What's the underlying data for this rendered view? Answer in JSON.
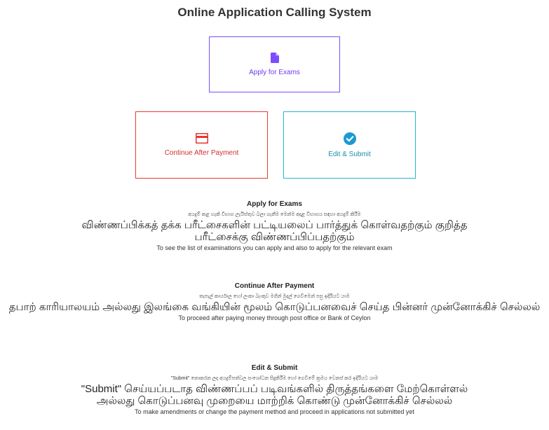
{
  "page": {
    "title": "Online Application Calling System"
  },
  "cards": {
    "apply": {
      "label": "Apply for Exams",
      "icon": "document-icon",
      "color": "#7c4dff"
    },
    "continue": {
      "label": "Continue After Payment",
      "icon": "credit-card-icon",
      "color": "#e53935"
    },
    "edit": {
      "label": "Edit & Submit",
      "icon": "check-circle-icon",
      "color": "#26b5d3"
    }
  },
  "sections": {
    "apply": {
      "heading": "Apply for Exams",
      "sinhala": "අයදුම් කළ හැකි විභාග ලැයිස්තුව බලා ගැනීම මෙන්ම අදාළ විභාගය සඳහා අයදුම් කිරීම",
      "tamil": "விண்ணப்பிக்கத் தக்க பரீட்சைகளின் பட்டியலைப் பார்த்துக் கொள்வதற்கும் குறித்த பரீட்சைக்கு விண்ணப்பிப்பதற்கும்",
      "english": "To see the list of examinations you can apply and also to apply for the relevant exam"
    },
    "continue": {
      "heading": "Continue After Payment",
      "sinhala": "තැපැල් කාර්යාල හෝ ලංකා බැංකුව මගින් මුදල් ගෙවීමෙන් පසු ඉදිරියට යාම",
      "tamil": "தபாற் காரியாலயம் அல்லது இலங்கை வங்கியின் மூலம் கொடுப்பனவைச் செய்த பின்னர் முன்னோக்கிச் செல்லல்",
      "english": "To proceed after paying money through post office or Bank of Ceylon"
    },
    "edit": {
      "heading": "Edit & Submit",
      "sinhala": "\"Submit\" නොකරන ලද අයදුම්පත්වල සංශෝධන සිදුකිරීම හෝ ගෙවීමේ ක්‍රමය වෙනස් කර ඉදිරියට යාම",
      "tamil": "\"Submit\" செய்யப்படாத விண்ணப்பப் படிவங்களில் திருத்தங்களை மேற்கொள்ளல் அல்லது கொடுப்பனவு முறையை மாற்றிக் கொண்டு முன்னோக்கிச் செல்லல்",
      "english": "To make amendments or change the payment method and proceed in applications not submitted yet"
    }
  }
}
